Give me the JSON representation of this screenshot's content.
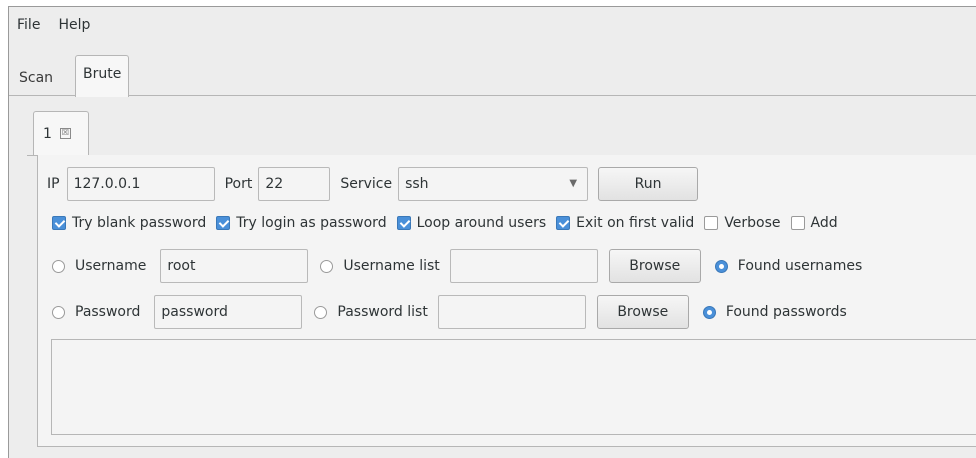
{
  "menu": {
    "file": "File",
    "help": "Help"
  },
  "tabs": {
    "scan": "Scan",
    "brute": "Brute"
  },
  "subtab": {
    "label": "1",
    "close": "☒"
  },
  "target": {
    "ip_label": "IP",
    "ip_value": "127.0.0.1",
    "port_label": "Port",
    "port_value": "22",
    "service_label": "Service",
    "service_value": "ssh",
    "run_label": "Run"
  },
  "options": {
    "blank": {
      "label": "Try blank password",
      "checked": true
    },
    "login": {
      "label": "Try login as password",
      "checked": true
    },
    "loop": {
      "label": "Loop around users",
      "checked": true
    },
    "exit": {
      "label": "Exit on first valid",
      "checked": true
    },
    "verbose": {
      "label": "Verbose",
      "checked": false
    },
    "add": {
      "label": "Add",
      "checked": false
    }
  },
  "users": {
    "username_label": "Username",
    "username_value": "root",
    "list_label": "Username list",
    "list_value": "",
    "browse": "Browse",
    "found": "Found usernames"
  },
  "passwords": {
    "password_label": "Password",
    "password_value": "password",
    "list_label": "Password list",
    "list_value": "",
    "browse": "Browse",
    "found": "Found passwords"
  },
  "colors": {
    "accent": "#4a90d9",
    "background": "#ededed"
  }
}
